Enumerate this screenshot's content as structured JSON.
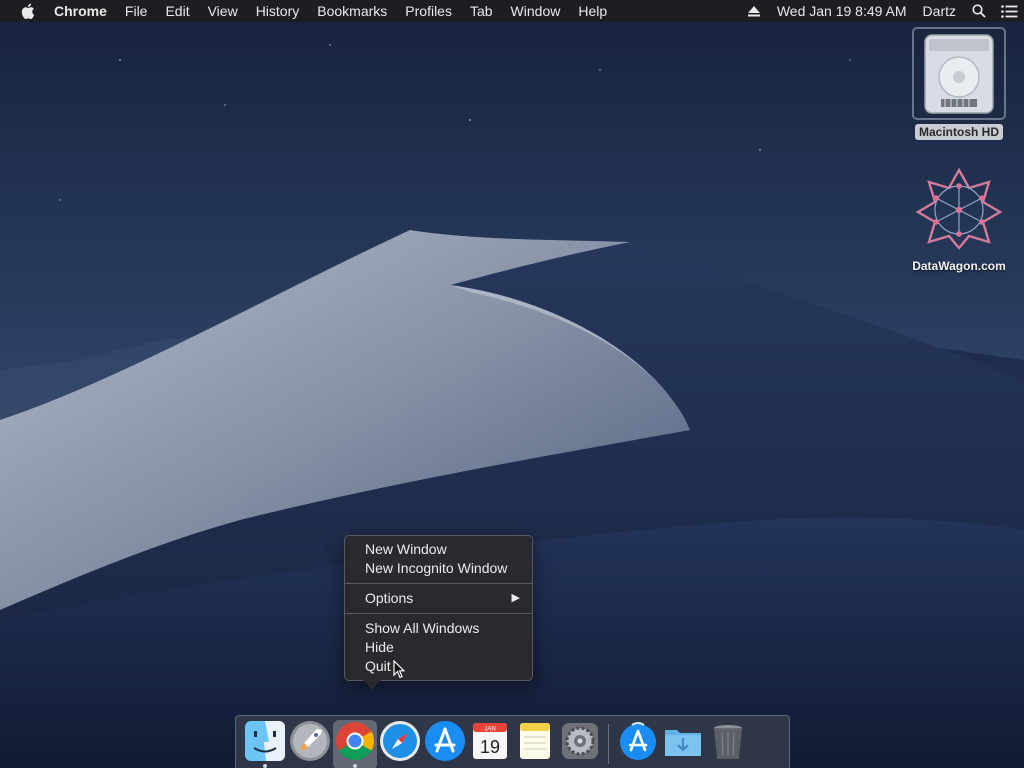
{
  "menubar": {
    "app_name": "Chrome",
    "items": [
      "File",
      "Edit",
      "View",
      "History",
      "Bookmarks",
      "Profiles",
      "Tab",
      "Window",
      "Help"
    ],
    "datetime": "Wed Jan 19  8:49 AM",
    "user": "Dartz"
  },
  "desktop": {
    "icons": [
      {
        "label": "Macintosh HD",
        "icon": "hard-drive-icon",
        "selected": true
      },
      {
        "label": "DataWagon.com",
        "icon": "datawagon-logo-icon",
        "selected": false
      }
    ]
  },
  "context_menu": {
    "groups": [
      [
        "New Window",
        "New Incognito Window"
      ],
      [
        "Options"
      ],
      [
        "Show All Windows",
        "Hide",
        "Quit"
      ]
    ],
    "submenu_arrow": "▶"
  },
  "dock": {
    "calendar": {
      "month": "JAN",
      "day": "19"
    },
    "items": [
      "finder-icon",
      "launchpad-icon",
      "chrome-icon",
      "safari-icon",
      "app-store-icon",
      "calendar-icon",
      "notes-icon",
      "system-preferences-icon",
      "app-store-download-icon",
      "downloads-folder-icon",
      "trash-icon"
    ],
    "running": [
      "finder-icon",
      "chrome-icon"
    ]
  },
  "colors": {
    "sky_top": "#1b2743",
    "sky_bottom": "#2e4368",
    "dune_light": "#8e97ab",
    "dune_dark": "#223154",
    "menu_bg": "#2a2a2e"
  }
}
